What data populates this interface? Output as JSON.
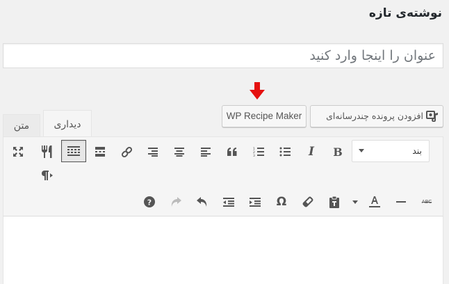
{
  "page": {
    "title": "نوشته‌ی تازه"
  },
  "title_field": {
    "placeholder": "عنوان را اینجا وارد کنید"
  },
  "buttons": {
    "add_media": "افزودن پرونده چندرسانه‌ای",
    "wp_recipe_maker": "WP Recipe Maker"
  },
  "tabs": {
    "visual": "دیداری",
    "text": "متن"
  },
  "format_select": {
    "value": "بند"
  },
  "toolbar": {
    "bold": "B",
    "italic": "I",
    "omega": "Ω",
    "strike": "ABC"
  },
  "colors": {
    "accent_arrow": "#e5100f",
    "icon": "#555555"
  }
}
